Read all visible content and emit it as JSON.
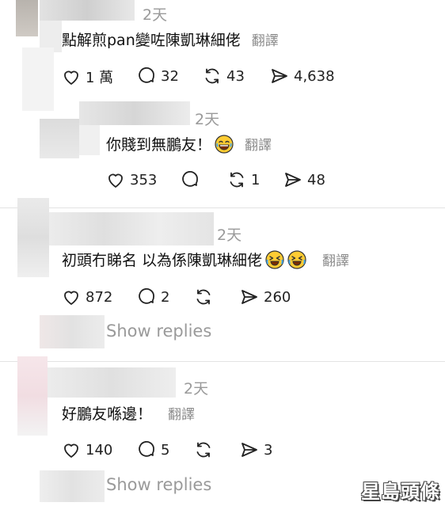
{
  "comments": [
    {
      "time": "2天",
      "text": "點解煎pan變咗陳凱琳細佬",
      "translate": "翻譯",
      "likes": "1 萬",
      "replies": "32",
      "reposts": "43",
      "shares": "4,638"
    },
    {
      "time": "2天",
      "text": "你賤到無鵬友！",
      "emoji": "joy-face-emoji",
      "translate": "翻譯",
      "likes": "353",
      "replies": "",
      "reposts": "1",
      "shares": "48"
    },
    {
      "time": "2天",
      "text": "初頭冇睇名 以為係陳凱琳細佬",
      "emoji": "laughing-face-emoji",
      "translate": "翻譯",
      "likes": "872",
      "replies": "2",
      "reposts": "",
      "shares": "260",
      "show_replies": "Show replies"
    },
    {
      "time": "2天",
      "text": "好鵬友喺邊！",
      "translate": "翻譯",
      "likes": "140",
      "replies": "5",
      "reposts": "",
      "shares": "3",
      "show_replies": "Show replies"
    }
  ],
  "watermark": "星島頭條",
  "colors": {
    "text": "#111111",
    "muted": "#9a9a9a",
    "divider": "#e3e3e3"
  }
}
